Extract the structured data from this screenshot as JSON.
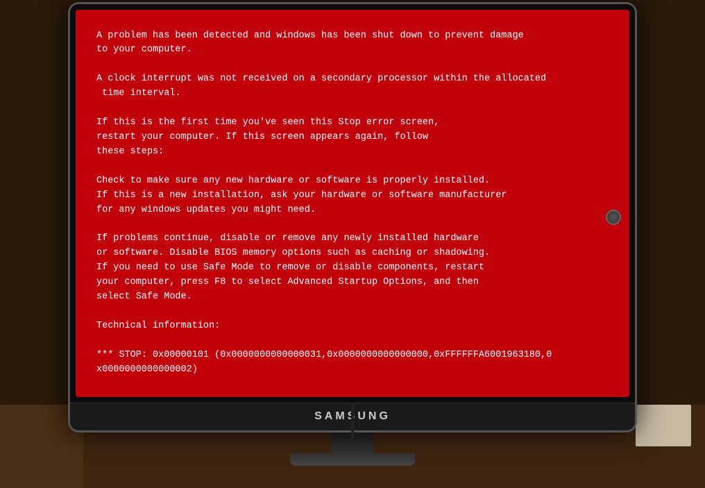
{
  "screen": {
    "background_color": "#c0000a",
    "text_color": "#ffffff",
    "lines": [
      "A problem has been detected and windows has been shut down to prevent damage",
      "to your computer.",
      "",
      "A clock interrupt was not received on a secondary processor within the allocated",
      " time interval.",
      "",
      "If this is the first time you've seen this Stop error screen,",
      "restart your computer. If this screen appears again, follow",
      "these steps:",
      "",
      "Check to make sure any new hardware or software is properly installed.",
      "If this is a new installation, ask your hardware or software manufacturer",
      "for any windows updates you might need.",
      "",
      "If problems continue, disable or remove any newly installed hardware",
      "or software. Disable BIOS memory options such as caching or shadowing.",
      "If you need to use Safe Mode to remove or disable components, restart",
      "your computer, press F8 to select Advanced Startup Options, and then",
      "select Safe Mode.",
      "",
      "Technical information:",
      "",
      "*** STOP: 0x00000101 (0x0000000000000031,0x0000000000000000,0xFFFFFFA6001963180,0",
      "x0000000000000002)"
    ]
  },
  "monitor": {
    "brand": "SAMSUNG"
  }
}
